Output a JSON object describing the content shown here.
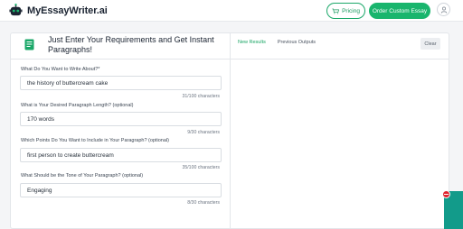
{
  "brand": {
    "name": "MyEssayWriter.ai",
    "accent": "#19b56d"
  },
  "nav": {
    "pricing_label": "Pricing",
    "order_label": "Order Custom Essay"
  },
  "form": {
    "heading": "Just Enter Your Requirements and Get Instant Paragraphs!",
    "fields": [
      {
        "label": "What Do You Want to Write About?*",
        "value": "the history of buttercream cake",
        "count": "31/100 characters"
      },
      {
        "label": "What is Your Desired Paragraph Length? (optional)",
        "value": "170 words",
        "count": "9/30 characters"
      },
      {
        "label": "Which Points Do You Want to Include in Your Paragraph? (optional)",
        "value": "first person to create buttercream",
        "count": "35/100 characters"
      },
      {
        "label": "What Should be the Tone of Your Paragraph? (optional)",
        "value": "Engaging",
        "count": "8/30 characters"
      }
    ]
  },
  "results": {
    "tab_new": "New Results",
    "tab_previous": "Previous Outputs",
    "clear_label": "Clear"
  }
}
